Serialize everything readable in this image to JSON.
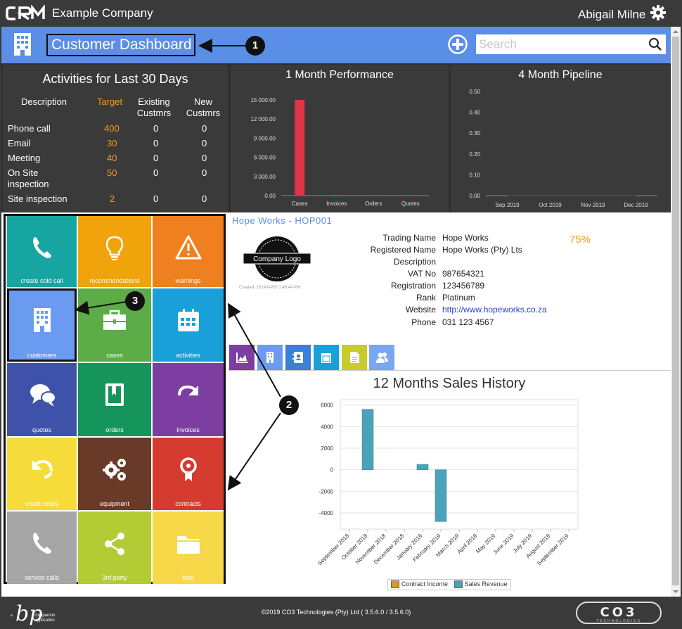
{
  "app": {
    "logo_text": "CRM",
    "company": "Example Company",
    "user": "Abigail Milne"
  },
  "header": {
    "title": "Customer Dashboard",
    "search_placeholder": "Search"
  },
  "activities": {
    "title": "Activities for Last 30 Days",
    "columns": [
      "Description",
      "Target",
      "Existing Custmrs",
      "New Custmrs"
    ],
    "rows": [
      {
        "description": "Phone call",
        "target": "400",
        "existing": "0",
        "new": "0"
      },
      {
        "description": "Email",
        "target": "30",
        "existing": "0",
        "new": "0"
      },
      {
        "description": "Meeting",
        "target": "40",
        "existing": "0",
        "new": "0"
      },
      {
        "description": "On Site inspection",
        "target": "50",
        "existing": "0",
        "new": "0"
      },
      {
        "description": "Site inspection",
        "target": "2",
        "existing": "0",
        "new": "0"
      }
    ]
  },
  "chart_data": [
    {
      "type": "bar",
      "title": "1 Month Performance",
      "categories": [
        "Cases",
        "Invoices",
        "Orders",
        "Quotes"
      ],
      "values": [
        15000,
        80,
        30,
        60
      ],
      "ylim": [
        0,
        15000
      ],
      "yticks": [
        "0.00",
        "3 000.00",
        "6 000.00",
        "9 000.00",
        "12 000.00",
        "15 000.00"
      ],
      "color": "#e0344a"
    },
    {
      "type": "line",
      "title": "4 Month Pipeline",
      "categories": [
        "Sep 2019",
        "Oct 2019",
        "Nov 2019",
        "Dec 2019"
      ],
      "values": [
        0,
        0,
        0,
        0
      ],
      "ylim": [
        0,
        0.5
      ],
      "yticks": [
        "0.00",
        "0.10",
        "0.20",
        "0.30",
        "0.40",
        "0.50"
      ]
    },
    {
      "type": "bar",
      "title": "12 Months Sales History",
      "categories": [
        "September 2018",
        "October 2018",
        "November 2018",
        "December 2018",
        "January 2019",
        "February 2019",
        "March 2019",
        "April 2019",
        "May 2019",
        "June 2019",
        "July 2019",
        "August 2019",
        "September 2019"
      ],
      "series": [
        {
          "name": "Contract Income",
          "color": "#d99a1e",
          "values": [
            0,
            0,
            0,
            0,
            0,
            0,
            0,
            0,
            0,
            0,
            0,
            0,
            0
          ]
        },
        {
          "name": "Sales Revenue",
          "color": "#4aa3b8",
          "values": [
            0,
            5600,
            0,
            0,
            500,
            -4800,
            0,
            0,
            0,
            0,
            0,
            0,
            0
          ]
        }
      ],
      "ylim": [
        -5500,
        6500
      ],
      "yticks": [
        "-4000",
        "-2000",
        "0",
        "2000",
        "4000",
        "6000"
      ],
      "grid": true,
      "legend": "bottom"
    }
  ],
  "tiles": [
    {
      "label": "create cold call",
      "color": "#16a5a0",
      "icon": "phone-icon"
    },
    {
      "label": "recommendations",
      "color": "#f0a30a",
      "icon": "lightbulb-icon"
    },
    {
      "label": "warnings",
      "color": "#f0801f",
      "icon": "warning-icon"
    },
    {
      "label": "customers",
      "color": "#6b9bf0",
      "icon": "building-icon"
    },
    {
      "label": "cases",
      "color": "#5cac47",
      "icon": "briefcase-icon"
    },
    {
      "label": "activities",
      "color": "#1aa0d8",
      "icon": "calendar-icon"
    },
    {
      "label": "quotes",
      "color": "#3d52a8",
      "icon": "chat-bubbles-icon"
    },
    {
      "label": "orders",
      "color": "#15945b",
      "icon": "bookmark-book-icon"
    },
    {
      "label": "invoices",
      "color": "#7c3ea0",
      "icon": "redo-arrow-icon"
    },
    {
      "label": "credit notes",
      "color": "#f5dc3a",
      "icon": "undo-arrow-icon"
    },
    {
      "label": "equipment",
      "color": "#6a3a28",
      "icon": "gears-icon"
    },
    {
      "label": "contracts",
      "color": "#d63b30",
      "icon": "award-ribbon-icon"
    },
    {
      "label": "service calls",
      "color": "#a5a5a5",
      "icon": "phone-icon"
    },
    {
      "label": "3rd party",
      "color": "#b3cc35",
      "icon": "share-icon"
    },
    {
      "label": "files",
      "color": "#f7d848",
      "icon": "folder-icon"
    }
  ],
  "customer": {
    "title": "Hope Works - HOP001",
    "logo_text": "Company Logo",
    "created": "Created: 2014/04/03 1:46:44 PM",
    "percent": "75%",
    "fields": [
      {
        "label": "Trading Name",
        "value": "Hope Works"
      },
      {
        "label": "Registered Name",
        "value": "Hope Works (Pty) Lts"
      },
      {
        "label": "Description",
        "value": ""
      },
      {
        "label": "VAT No",
        "value": "987654321"
      },
      {
        "label": "Registration",
        "value": "123456789"
      },
      {
        "label": "Rank",
        "value": "Platinum"
      },
      {
        "label": "Website",
        "value": "http://www.hopeworks.co.za"
      },
      {
        "label": "Phone",
        "value": "031 123 4567"
      }
    ]
  },
  "detail_tabs": [
    {
      "icon": "area-chart-icon",
      "color": "#7c3ea0"
    },
    {
      "icon": "building-icon",
      "color": "#6b9bf0"
    },
    {
      "icon": "contacts-book-icon",
      "color": "#3d7ed8"
    },
    {
      "icon": "calendar-icon",
      "color": "#1aa0d8"
    },
    {
      "icon": "document-icon",
      "color": "#c8cc2a"
    },
    {
      "icon": "users-icon",
      "color": "#7aa8f0"
    }
  ],
  "annotations": [
    "1",
    "2",
    "3"
  ],
  "footer": {
    "copyright": "©2019 CO3 Technologies (Pty) Ltd ( 3.5.6.0 / 3.5.6.0)",
    "left_logo_text": "a companion application",
    "right_logo_text": "CO3 TECHNOLOGIES"
  }
}
